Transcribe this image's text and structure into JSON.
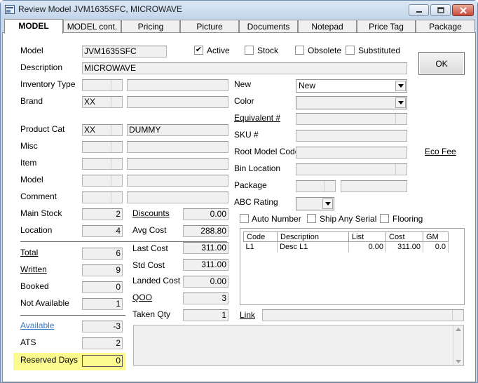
{
  "window": {
    "title": "Review Model JVM1635SFC, MICROWAVE",
    "minimize_icon": "minimize-icon",
    "maximize_icon": "maximize-icon",
    "close_icon": "close-icon"
  },
  "tabs": [
    {
      "label": "MODEL",
      "active": true
    },
    {
      "label": "MODEL cont."
    },
    {
      "label": "Pricing"
    },
    {
      "label": "Picture"
    },
    {
      "label": "Documents"
    },
    {
      "label": "Notepad"
    },
    {
      "label": "Price Tag"
    },
    {
      "label": "Package"
    }
  ],
  "header": {
    "model_label": "Model",
    "model_value": "JVM1635SFC",
    "description_label": "Description",
    "description_value": "MICROWAVE",
    "active_label": "Active",
    "active_checked": true,
    "stock_label": "Stock",
    "obsolete_label": "Obsolete",
    "substituted_label": "Substituted",
    "ok_label": "OK"
  },
  "left": {
    "inventory_type_label": "Inventory Type",
    "brand_label": "Brand",
    "brand_code": "XX",
    "product_cat_label": "Product Cat",
    "product_cat_code": "XX",
    "product_cat_desc": "DUMMY",
    "misc_label": "Misc",
    "item_label": "Item",
    "model_label": "Model",
    "comment_label": "Comment",
    "main_stock_label": "Main Stock",
    "main_stock_value": "2",
    "location_label": "Location",
    "location_value": "4",
    "total_label": "Total",
    "total_value": "6",
    "written_label": "Written",
    "written_value": "9",
    "booked_label": "Booked",
    "booked_value": "0",
    "not_available_label": "Not Available",
    "not_available_value": "1",
    "available_label": "Available",
    "available_value": "-3",
    "ats_label": "ATS",
    "ats_value": "2",
    "reserved_days_label": "Reserved Days",
    "reserved_days_value": "0",
    "highlight_color": "#fbfa8f"
  },
  "costs": {
    "discounts_label": "Discounts",
    "discounts_value": "0.00",
    "avg_cost_label": "Avg Cost",
    "avg_cost_value": "288.80",
    "last_cost_label": "Last Cost",
    "last_cost_value": "311.00",
    "std_cost_label": "Std Cost",
    "std_cost_value": "311.00",
    "landed_cost_label": "Landed Cost",
    "landed_cost_value": "0.00",
    "qoo_label": "QOO",
    "qoo_value": "3",
    "taken_qty_label": "Taken Qty",
    "taken_qty_value": "1"
  },
  "right": {
    "new_label": "New",
    "new_value": "New",
    "color_label": "Color",
    "equivalent_label": "Equivalent #",
    "sku_label": "SKU #",
    "root_model_label": "Root Model Code",
    "eco_fee_label": "Eco Fee",
    "bin_location_label": "Bin Location",
    "package_label": "Package",
    "abc_rating_label": "ABC Rating",
    "auto_number_label": "Auto Number",
    "ship_any_serial_label": "Ship Any Serial",
    "flooring_label": "Flooring",
    "link_label": "Link"
  },
  "price_grid": {
    "columns": [
      "Code",
      "Description",
      "List",
      "Cost",
      "GM"
    ],
    "rows": [
      {
        "code": "L1",
        "description": "Desc L1",
        "list": "0.00",
        "cost": "311.00",
        "gm": "0.0"
      }
    ]
  }
}
